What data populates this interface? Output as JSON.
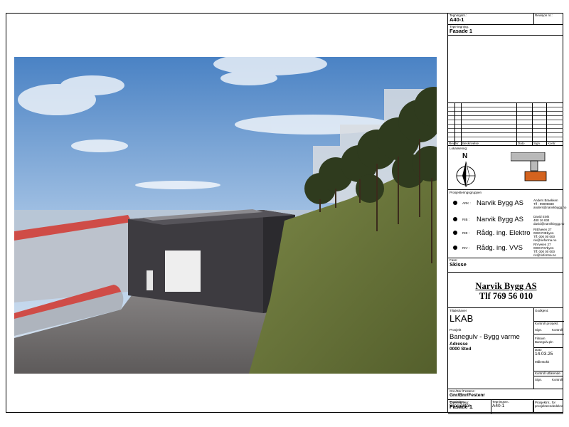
{
  "title_block": {
    "drawing_no_label": "Tegningsnr.:",
    "drawing_no": "A40-1",
    "revision_label": "Revisjon nr.:",
    "drawing_type_label": "Type tegning:",
    "drawing_type": "Fasade 1",
    "rev_table_headers": [
      "Rev",
      "Nr.",
      "Beskrivelse",
      "Dato",
      "Sign",
      "Kontr."
    ],
    "location_label": "Lokalisering:",
    "north_letter": "N",
    "project_group_label": "Prosjekteringsgruppen",
    "disciplines": [
      {
        "code": "ARK :",
        "name": "Narvik Bygg AS",
        "contact": [
          "Anders Braekken",
          "Tlf : 99095688",
          "anders@narvikbygg.no"
        ]
      },
      {
        "code": "RIB :",
        "name": "Narvik Bygg AS",
        "contact": [
          "David Eivik",
          "480 16 834",
          "david@narvikbygg.no"
        ]
      },
      {
        "code": "RIE :",
        "name": "Rådg. ing. Elektro",
        "contact": [
          "RIElveien 27",
          "0000 RIEbyen",
          "Tlf: 000 00 000",
          "rie@rieforma.no"
        ]
      },
      {
        "code": "RIV :",
        "name": "Rådg. ing. VVS",
        "contact": [
          "RIVveien 27",
          "0000 RIVbyen",
          "Tlf: 000 00 000",
          "riv@rivforma.no"
        ]
      }
    ],
    "phase_label": "Fase:",
    "phase": "Skisse",
    "company": "Narvik Bygg AS",
    "company_phone": "Tlf 769 56 010",
    "client_label": "Tiltakshaver",
    "client": "LKAB",
    "approved_label": "Godkjent:",
    "control_project_label": "Kontroll prosjekt.",
    "sign_label": "Sign.",
    "control_label": "Kontroll",
    "project_label": "Prosjekt",
    "project_name": "Banegulv - Bygg varme",
    "address_label": "Adresse",
    "address": "0000 Sted",
    "filename_label": "Filnavn",
    "filename": "Banegulv.pln",
    "date_label": "Dato",
    "date": "14.03.25",
    "scale_label": "Målestokk",
    "control_exec_label": "Kontroll utførende",
    "sign2_label": "Sign.",
    "control2_label": "Kontroll",
    "gnr_label": "Gnr./Bnr./Festenr.:",
    "gnr": "Gnr/Bnr/Festenr",
    "project_no_label": "Prosjektnr.:",
    "project_no": "Prosjektnr_",
    "drawing_no2_label": "Tegningsnr.:",
    "drawing_no2": "A40-1",
    "project_no_note": "Prosjektnr., for prosjekteendedelev.",
    "drawing_type2_label": "Type tegning:",
    "drawing_type2": "Fasade 1"
  },
  "colors": {
    "sky_top": "#4f86c6",
    "sky_bottom": "#c9dcef",
    "grass": "#6b7a3c",
    "building": "#3c3a3e",
    "roof_red": "#d4504a",
    "gravel": "#6e6b6a",
    "location_gray": "#b9b9b9",
    "location_orange": "#d4631f"
  }
}
